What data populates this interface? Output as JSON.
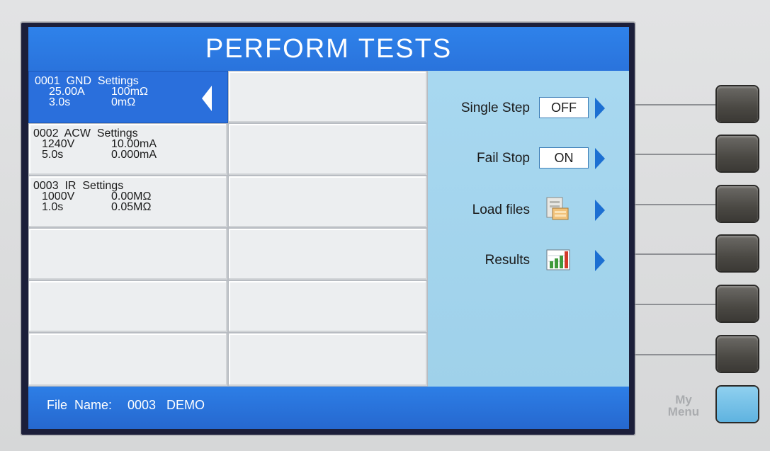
{
  "title": "PERFORM TESTS",
  "steps": [
    {
      "line1": "0001  GND  Settings",
      "val_a": "25.00A",
      "val_b": "100mΩ",
      "val_c": "3.0s",
      "val_d": "0mΩ",
      "selected": true
    },
    {
      "line1": "0002  ACW  Settings",
      "val_a": "1240V",
      "val_b": "10.00mA",
      "val_c": "5.0s",
      "val_d": "0.000mA",
      "selected": false
    },
    {
      "line1": "0003  IR  Settings",
      "val_a": "1000V",
      "val_b": "0.00MΩ",
      "val_c": "1.0s",
      "val_d": "0.05MΩ",
      "selected": false
    }
  ],
  "menu": {
    "single_step": {
      "label": "Single  Step",
      "value": "OFF"
    },
    "fail_stop": {
      "label": "Fail  Stop",
      "value": "ON"
    },
    "load_files": {
      "label": "Load  files",
      "icon": "file-cabinet-icon"
    },
    "results": {
      "label": "Results",
      "icon": "bar-chart-icon"
    }
  },
  "status": {
    "file_name_label": "File  Name:",
    "file_name_value": "0003   DEMO"
  },
  "hardware": {
    "my_menu_label_1": "My",
    "my_menu_label_2": "Menu"
  },
  "colors": {
    "title_blue": "#2e82ea",
    "menu_panel": "#a8d8f0",
    "selected_row": "#2a6fdc",
    "accent_arrow": "#1c6fd2"
  }
}
